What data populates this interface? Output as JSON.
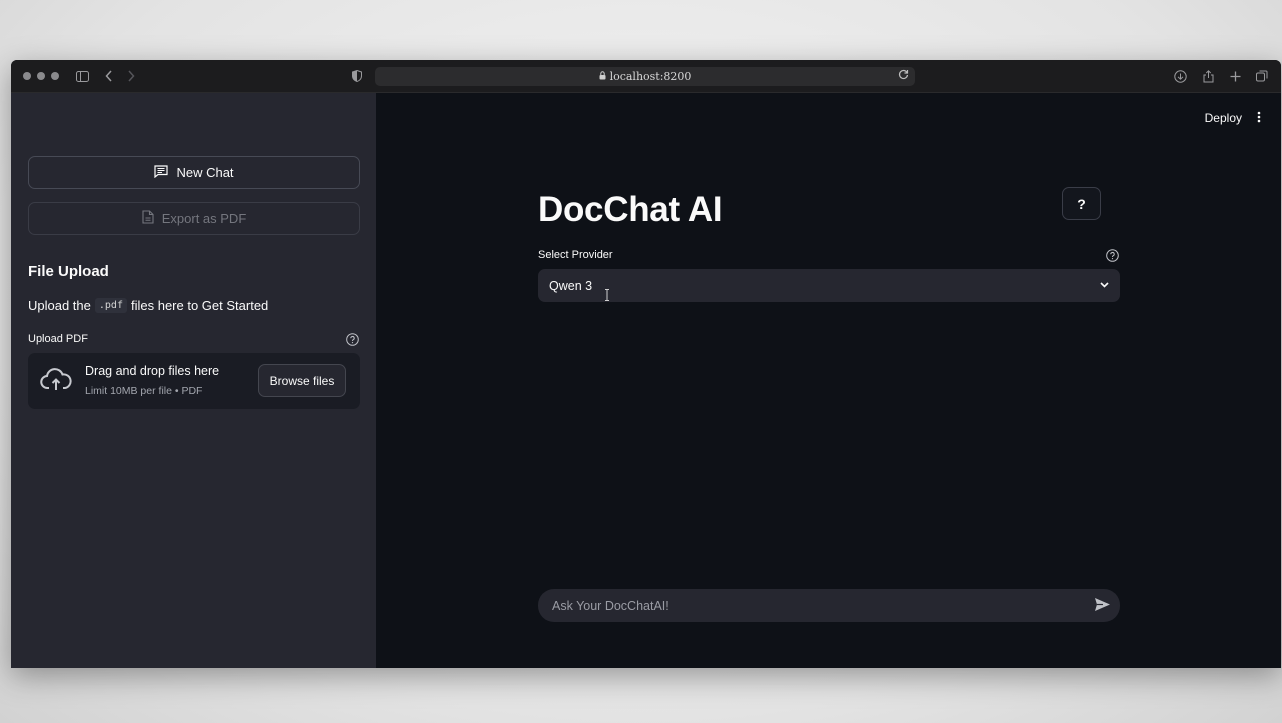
{
  "browser": {
    "url": "localhost:8200"
  },
  "sidebar": {
    "new_chat_label": "New Chat",
    "export_label": "Export as PDF",
    "section_title": "File Upload",
    "upload_text_before": "Upload the",
    "upload_code": ".pdf",
    "upload_text_after": "files here to Get Started",
    "upload_label": "Upload PDF",
    "dropzone_title": "Drag and drop files here",
    "dropzone_limit": "Limit 10MB per file • PDF",
    "browse_label": "Browse files"
  },
  "header": {
    "deploy_label": "Deploy"
  },
  "main": {
    "title": "DocChat AI",
    "help_button_label": "?",
    "provider_label": "Select Provider",
    "provider_selected": "Qwen 3",
    "chat_placeholder": "Ask Your DocChatAI!"
  },
  "colors": {
    "sidebar_bg": "#262730",
    "main_bg": "#0e1117",
    "text": "#fafafa"
  }
}
